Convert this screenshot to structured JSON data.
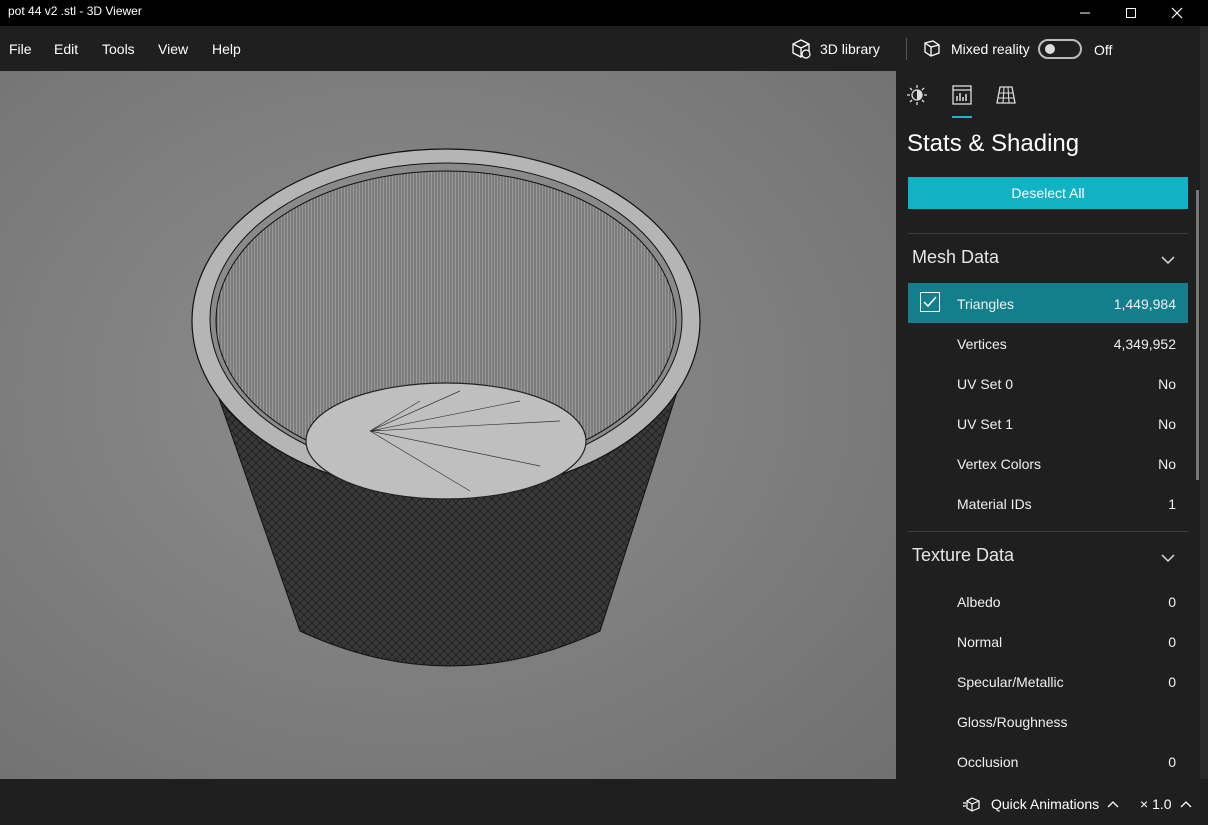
{
  "window": {
    "title": "pot 44 v2 .stl - 3D Viewer"
  },
  "menu": {
    "items": [
      "File",
      "Edit",
      "Tools",
      "View",
      "Help"
    ],
    "library_label": "3D library",
    "mixed_reality_label": "Mixed reality",
    "mixed_reality_state": "Off"
  },
  "panel": {
    "tabs": [
      "lighting-icon",
      "stats-icon",
      "grid-icon"
    ],
    "active_tab": 1,
    "title": "Stats & Shading",
    "deselect_label": "Deselect All",
    "mesh_section": "Mesh Data",
    "mesh_rows": [
      {
        "label": "Triangles",
        "value": "1,449,984",
        "checked": true
      },
      {
        "label": "Vertices",
        "value": "4,349,952"
      },
      {
        "label": "UV Set 0",
        "value": "No"
      },
      {
        "label": "UV Set 1",
        "value": "No"
      },
      {
        "label": "Vertex Colors",
        "value": "No"
      },
      {
        "label": "Material IDs",
        "value": "1"
      }
    ],
    "texture_section": "Texture Data",
    "texture_rows": [
      {
        "label": "Albedo",
        "value": "0"
      },
      {
        "label": "Normal",
        "value": "0"
      },
      {
        "label": "Specular/Metallic",
        "value": "0"
      },
      {
        "label": "Gloss/Roughness",
        "value": ""
      },
      {
        "label": "Occlusion",
        "value": "0"
      }
    ]
  },
  "bottom": {
    "quick_animations": "Quick Animations",
    "speed": "× 1.0"
  },
  "colors": {
    "accent": "#11b2c4",
    "selected_row": "#137f8c",
    "background": "#1f1f1f",
    "viewport": "#828282"
  }
}
